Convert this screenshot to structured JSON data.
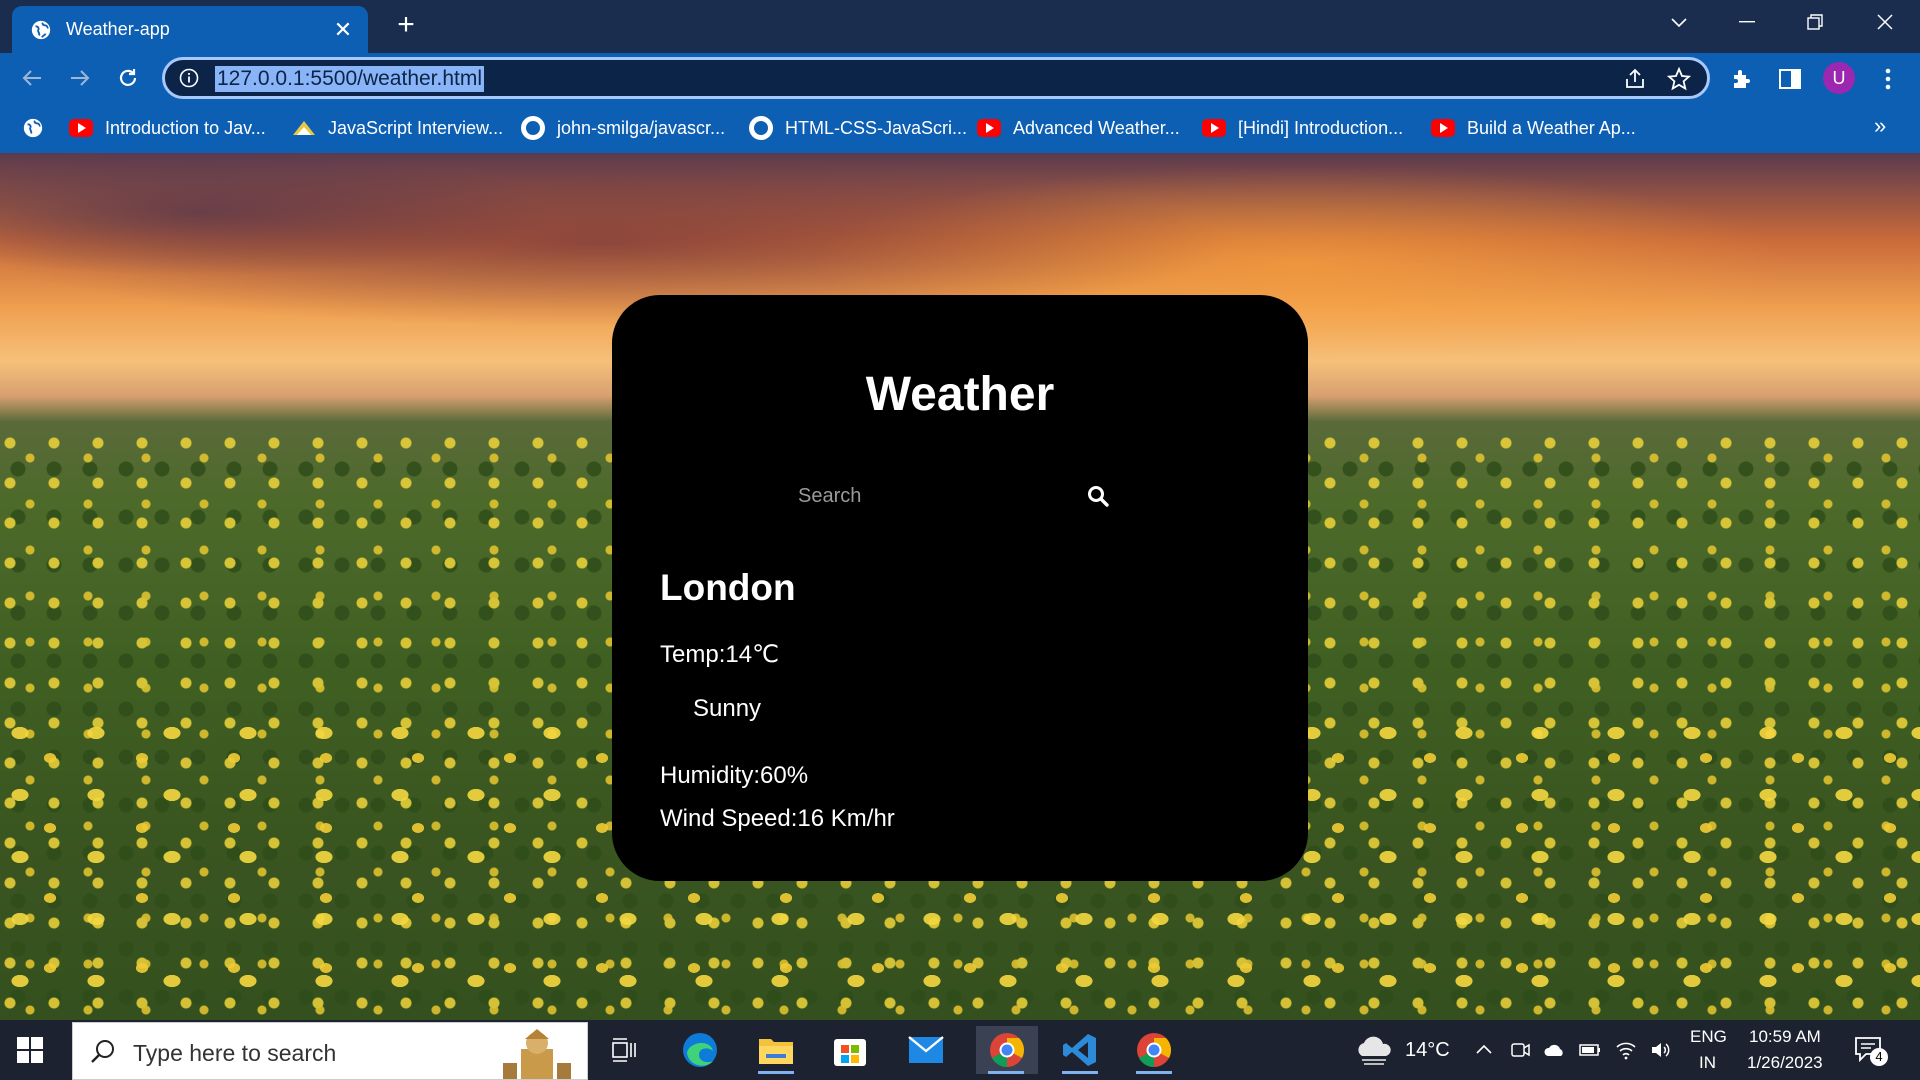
{
  "browser": {
    "tab_title": "Weather-app",
    "tab_close": "✕",
    "new_tab": "+",
    "url": "127.0.0.1:5500/weather.html",
    "bookmarks": [
      {
        "label": "Introduction to Jav...",
        "icon": "youtube-icon"
      },
      {
        "label": "JavaScript Interview...",
        "icon": "site-icon"
      },
      {
        "label": "john-smilga/javascr...",
        "icon": "github-icon"
      },
      {
        "label": "HTML-CSS-JavaScri...",
        "icon": "github-icon"
      },
      {
        "label": "Advanced Weather...",
        "icon": "youtube-icon"
      },
      {
        "label": "[Hindi] Introduction...",
        "icon": "youtube-icon"
      },
      {
        "label": "Build a Weather Ap...",
        "icon": "youtube-icon"
      }
    ],
    "more_bookmarks": "»",
    "profile_initial": "U"
  },
  "weather": {
    "title": "Weather",
    "search_placeholder": "Search",
    "city": "London",
    "temp": "Temp:14℃",
    "condition": "Sunny",
    "humidity": "Humidity:60%",
    "wind": "Wind Speed:16 Km/hr"
  },
  "taskbar": {
    "search_placeholder": "Type here to search",
    "weather_temp": "14°C",
    "language": "ENG",
    "region": "IN",
    "time": "10:59 AM",
    "date": "1/26/2023",
    "notification_count": "4"
  },
  "colors": {
    "chrome_dark": "#1b2d4e",
    "chrome_blue": "#0d5fb4",
    "card_bg": "#000000",
    "url_highlight": "#8ab4f8"
  }
}
